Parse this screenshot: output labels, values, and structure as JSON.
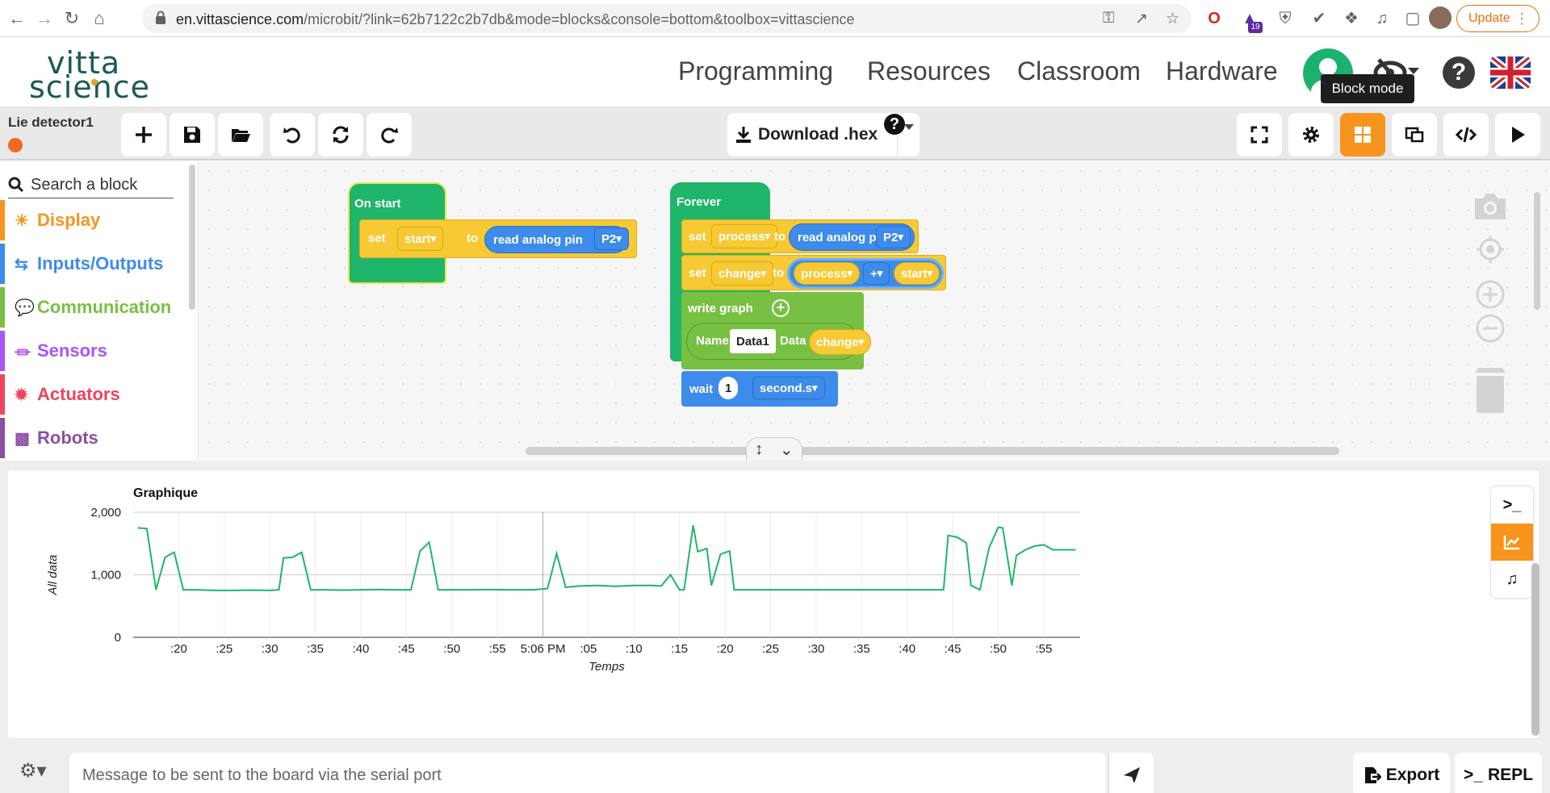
{
  "browser": {
    "url_host": "en.vittascience.com",
    "url_path": "/microbit/?link=62b7122c2b7db&mode=blocks&console=bottom&toolbox=vittascience",
    "extension_badge": "19",
    "update_label": "Update"
  },
  "site": {
    "nav": [
      "Programming",
      "Resources",
      "Classroom",
      "Hardware"
    ],
    "tooltip": "Block mode"
  },
  "toolbar": {
    "project_name": "Lie detector1",
    "download_label": "Download .hex",
    "download_help": "?"
  },
  "sidebar": {
    "search_placeholder": "Search a block",
    "categories": [
      {
        "label": "Display",
        "color": "#f7941d"
      },
      {
        "label": "Inputs/Outputs",
        "color": "#3d8bea"
      },
      {
        "label": "Communication",
        "color": "#78c043"
      },
      {
        "label": "Sensors",
        "color": "#a855f7"
      },
      {
        "label": "Actuators",
        "color": "#ef4461"
      },
      {
        "label": "Robots",
        "color": "#8a4fa0"
      }
    ]
  },
  "blocks": {
    "on_start": {
      "hat": "On start",
      "set": "set",
      "var": "start",
      "to": "to",
      "read": "read analog pin",
      "pin": "P2"
    },
    "forever": {
      "hat": "Forever",
      "set1": "set",
      "var1": "process",
      "to1": "to",
      "read1": "read analog pin",
      "pin1": "P2",
      "set2": "set",
      "var2": "change",
      "to2": "to",
      "op_left": "process",
      "op": "+",
      "op_right": "start",
      "write_graph": "write graph",
      "name_label": "Name",
      "name_value": "Data1",
      "data_label": "Data",
      "data_value": "change",
      "wait": "wait",
      "wait_value": "1",
      "wait_unit": "second.s"
    }
  },
  "console": {
    "message_placeholder": "Message to be sent to the board via the serial port",
    "export_label": "Export",
    "repl_label": "REPL"
  },
  "chart_data": {
    "type": "line",
    "title": "Graphique",
    "xlabel": "Temps",
    "ylabel": "All data",
    "ylim": [
      0,
      2000
    ],
    "y_ticks": [
      "0",
      "1,000",
      "2,000"
    ],
    "x_ticks": [
      ":20",
      ":25",
      ":30",
      ":35",
      ":40",
      ":45",
      ":50",
      ":55",
      "5:06 PM",
      ":05",
      ":10",
      ":15",
      ":20",
      ":25",
      ":30",
      ":35",
      ":40",
      ":45",
      ":50",
      ":55"
    ],
    "line_color": "#1fb56a",
    "grid": true,
    "series": [
      {
        "name": "Data1",
        "x": [
          15.5,
          16.5,
          17.5,
          18.5,
          19.5,
          20.5,
          22,
          24,
          26,
          28,
          30,
          31,
          31.5,
          32.5,
          33.5,
          34.5,
          36,
          38,
          40,
          42,
          44,
          45.5,
          46.5,
          47.5,
          48.5,
          50,
          52,
          54,
          56,
          58,
          59,
          60.5,
          61.5,
          62.5,
          64,
          66,
          68,
          70,
          72,
          73,
          74,
          75,
          75.5,
          76.5,
          77,
          78,
          78.5,
          79.5,
          80.5,
          81,
          82.5,
          84,
          86,
          88,
          90,
          92,
          94,
          96,
          98,
          100,
          102,
          104,
          104.5,
          105.5,
          106.5,
          107,
          108,
          109,
          110,
          110.5,
          111.5,
          112,
          113,
          114,
          115,
          116,
          117,
          118.5
        ],
        "values": [
          1750,
          1740,
          760,
          1280,
          1360,
          760,
          760,
          750,
          750,
          755,
          750,
          760,
          1270,
          1280,
          1360,
          760,
          760,
          755,
          760,
          765,
          760,
          760,
          1380,
          1520,
          760,
          760,
          760,
          765,
          760,
          760,
          760,
          780,
          1340,
          800,
          820,
          830,
          815,
          830,
          830,
          820,
          1000,
          760,
          760,
          1790,
          1370,
          1420,
          830,
          1330,
          1380,
          760,
          760,
          760,
          760,
          760,
          760,
          760,
          760,
          760,
          760,
          760,
          760,
          760,
          1630,
          1600,
          1510,
          830,
          760,
          1430,
          1760,
          1750,
          830,
          1310,
          1400,
          1460,
          1480,
          1400,
          1400,
          1400
        ]
      }
    ]
  }
}
